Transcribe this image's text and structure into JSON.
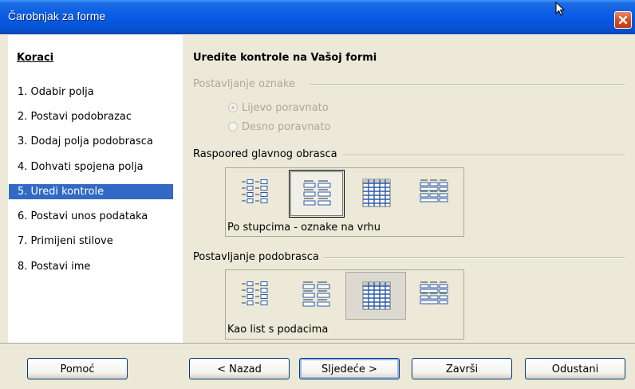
{
  "window": {
    "title": "Čarobnjak za forme",
    "title_bar_color": "#0a5ce6",
    "close_icon": "close-icon"
  },
  "steps": {
    "title": "Koraci",
    "items": [
      {
        "label": "1.  Odabir polja",
        "selected": false
      },
      {
        "label": "2.  Postavi podobrazac",
        "selected": false
      },
      {
        "label": "3.  Dodaj polja podobrasca",
        "selected": false
      },
      {
        "label": "4.  Dohvati spojena polja",
        "selected": false
      },
      {
        "label": "5.  Uredi kontrole",
        "selected": true
      },
      {
        "label": "6.  Postavi unos podataka",
        "selected": false
      },
      {
        "label": "7.  Primijeni stilove",
        "selected": false
      },
      {
        "label": "8.  Postavi ime",
        "selected": false
      }
    ],
    "selected_color": "#316ac5"
  },
  "main": {
    "heading": "Uredite kontrole na Vašoj formi",
    "label_placement": {
      "title": "Postavljanje oznake",
      "options": [
        {
          "label": "Lijevo poravnato",
          "checked": true
        },
        {
          "label": "Desno poravnato",
          "checked": false
        }
      ],
      "enabled": false
    },
    "main_layout": {
      "title": "Raspoored glavnog obrasca",
      "selected_index": 1,
      "caption": "Po stupcima - oznake na vrhu",
      "options": [
        "columnar-left-labels",
        "columnar-top-labels",
        "datasheet",
        "block-top-labels"
      ]
    },
    "subform_layout": {
      "title": "Postavljanje podobrasca",
      "selected_index": 2,
      "caption": "Kao list s podacima",
      "options": [
        "columnar-left-labels",
        "columnar-top-labels",
        "datasheet",
        "block-top-labels"
      ]
    }
  },
  "buttons": {
    "help": "Pomoć",
    "back": "< Nazad",
    "next": "Sljedeće >",
    "finish": "Završi",
    "cancel": "Odustani"
  }
}
